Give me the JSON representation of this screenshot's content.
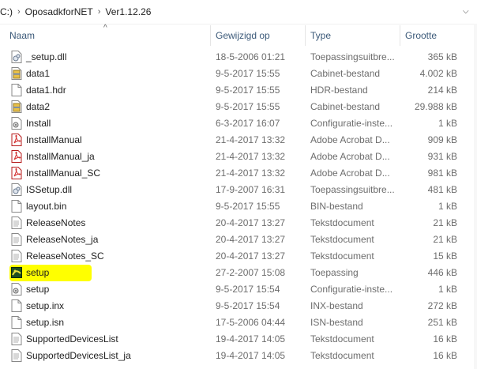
{
  "breadcrumb": [
    "C:)",
    "OposadkforNET",
    "Ver1.12.26"
  ],
  "columns": {
    "name": "Naam",
    "date": "Gewijzigd op",
    "type": "Type",
    "size": "Grootte"
  },
  "files": [
    {
      "name": "_setup.dll",
      "date": "18-5-2006 01:21",
      "type": "Toepassingsuitbre...",
      "size": "365 kB",
      "icon": "dll-file-icon"
    },
    {
      "name": "data1",
      "date": "9-5-2017 15:55",
      "type": "Cabinet-bestand",
      "size": "4.002 kB",
      "icon": "cabinet-file-icon"
    },
    {
      "name": "data1.hdr",
      "date": "9-5-2017 15:55",
      "type": "HDR-bestand",
      "size": "214 kB",
      "icon": "generic-file-icon"
    },
    {
      "name": "data2",
      "date": "9-5-2017 15:55",
      "type": "Cabinet-bestand",
      "size": "29.988 kB",
      "icon": "cabinet-file-icon"
    },
    {
      "name": "Install",
      "date": "6-3-2017 16:07",
      "type": "Configuratie-inste...",
      "size": "1 kB",
      "icon": "config-file-icon"
    },
    {
      "name": "InstallManual",
      "date": "21-4-2017 13:32",
      "type": "Adobe Acrobat D...",
      "size": "909 kB",
      "icon": "pdf-file-icon"
    },
    {
      "name": "InstallManual_ja",
      "date": "21-4-2017 13:32",
      "type": "Adobe Acrobat D...",
      "size": "931 kB",
      "icon": "pdf-file-icon"
    },
    {
      "name": "InstallManual_SC",
      "date": "21-4-2017 13:32",
      "type": "Adobe Acrobat D...",
      "size": "981 kB",
      "icon": "pdf-file-icon"
    },
    {
      "name": "ISSetup.dll",
      "date": "17-9-2007 16:31",
      "type": "Toepassingsuitbre...",
      "size": "481 kB",
      "icon": "dll-file-icon"
    },
    {
      "name": "layout.bin",
      "date": "9-5-2017 15:55",
      "type": "BIN-bestand",
      "size": "1 kB",
      "icon": "generic-file-icon"
    },
    {
      "name": "ReleaseNotes",
      "date": "20-4-2017 13:27",
      "type": "Tekstdocument",
      "size": "21 kB",
      "icon": "text-file-icon"
    },
    {
      "name": "ReleaseNotes_ja",
      "date": "20-4-2017 13:27",
      "type": "Tekstdocument",
      "size": "21 kB",
      "icon": "text-file-icon"
    },
    {
      "name": "ReleaseNotes_SC",
      "date": "20-4-2017 13:27",
      "type": "Tekstdocument",
      "size": "15 kB",
      "icon": "text-file-icon"
    },
    {
      "name": "setup",
      "date": "27-2-2007 15:08",
      "type": "Toepassing",
      "size": "446 kB",
      "icon": "setup-exe-icon",
      "highlighted": true
    },
    {
      "name": "setup",
      "date": "9-5-2017 15:54",
      "type": "Configuratie-inste...",
      "size": "1 kB",
      "icon": "config-file-icon"
    },
    {
      "name": "setup.inx",
      "date": "9-5-2017 15:54",
      "type": "INX-bestand",
      "size": "272 kB",
      "icon": "generic-file-icon"
    },
    {
      "name": "setup.isn",
      "date": "17-5-2006 04:44",
      "type": "ISN-bestand",
      "size": "251 kB",
      "icon": "generic-file-icon"
    },
    {
      "name": "SupportedDevicesList",
      "date": "19-4-2017 14:05",
      "type": "Tekstdocument",
      "size": "16 kB",
      "icon": "text-file-icon"
    },
    {
      "name": "SupportedDevicesList_ja",
      "date": "19-4-2017 14:05",
      "type": "Tekstdocument",
      "size": "16 kB",
      "icon": "text-file-icon"
    }
  ],
  "colors": {
    "highlight": "#ffff00",
    "header_text": "#3c5a79",
    "pdf_red": "#d32f2f"
  }
}
